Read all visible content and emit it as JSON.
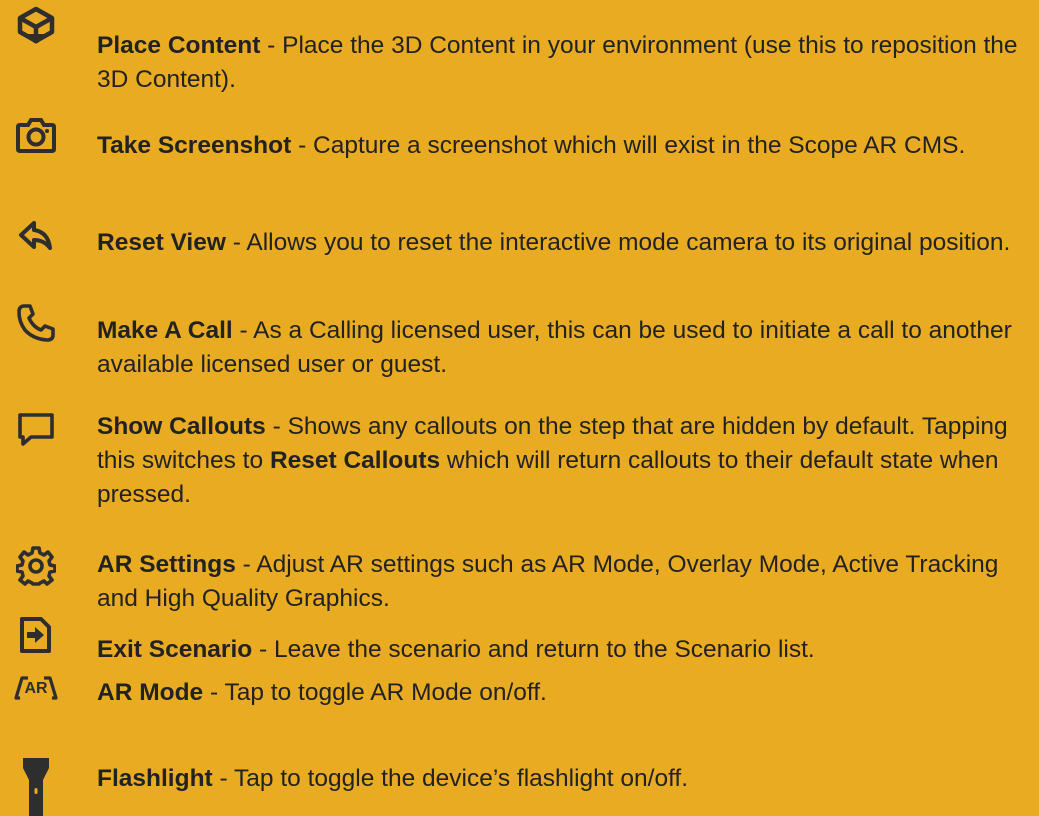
{
  "colors": {
    "background": "#E9AB22",
    "text": "#222222",
    "icon": "#2E2E2E"
  },
  "items": [
    {
      "icon": "place-content-icon",
      "title": "Place Content",
      "description": " - Place the 3D Content in your environment (use this to reposition the 3D Content)."
    },
    {
      "icon": "camera-icon",
      "title": "Take Screenshot",
      "description": " - Capture a screenshot which will exist in the Scope AR CMS."
    },
    {
      "icon": "reset-view-icon",
      "title": "Reset View",
      "description": " - Allows you to reset the interactive mode camera to its original position."
    },
    {
      "icon": "phone-icon",
      "title": "Make A Call",
      "description": " - As a Calling licensed user, this can be used to initiate a call to another available licensed user or guest."
    },
    {
      "icon": "callout-icon",
      "title": "Show Callouts",
      "description": " - Shows any callouts on the step that are hidden by default. Tapping this switches to ",
      "title2": "Reset Callouts",
      "description2": " which will return callouts to their default state when pressed."
    },
    {
      "icon": "gear-icon",
      "title": "AR Settings",
      "description": " - Adjust AR settings such as AR Mode, Overlay Mode, Active Tracking and High Quality Graphics."
    },
    {
      "icon": "exit-icon",
      "title": "Exit Scenario",
      "description": " - Leave the scenario and return to the Scenario list."
    },
    {
      "icon": "ar-mode-icon",
      "icon_text": "AR",
      "title": "AR Mode",
      "description": " - Tap to toggle AR Mode on/off."
    },
    {
      "icon": "flashlight-icon",
      "title": "Flashlight",
      "description": " - Tap to toggle the device’s flashlight on/off."
    }
  ]
}
